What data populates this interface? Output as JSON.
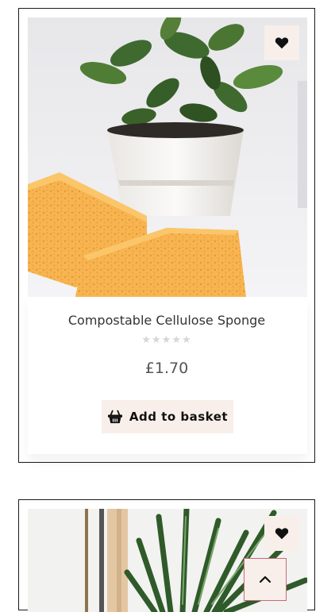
{
  "products": [
    {
      "title": "Compostable Cellulose Sponge",
      "rating_stars": "★★★★★",
      "price": "£1.70",
      "add_to_basket_label": "Add to basket",
      "image_icon": "sponge-and-plant-photo",
      "wishlist_icon": "heart-icon"
    },
    {
      "image_icon": "plant-and-brush-photo",
      "wishlist_icon": "heart-icon"
    }
  ],
  "back_to_top_icon": "chevron-up-icon",
  "colors": {
    "button_bg": "#f8efea",
    "back_to_top_border": "#c9697a",
    "sponge": "#f5b44f",
    "card_border": "#1a1a1a"
  }
}
